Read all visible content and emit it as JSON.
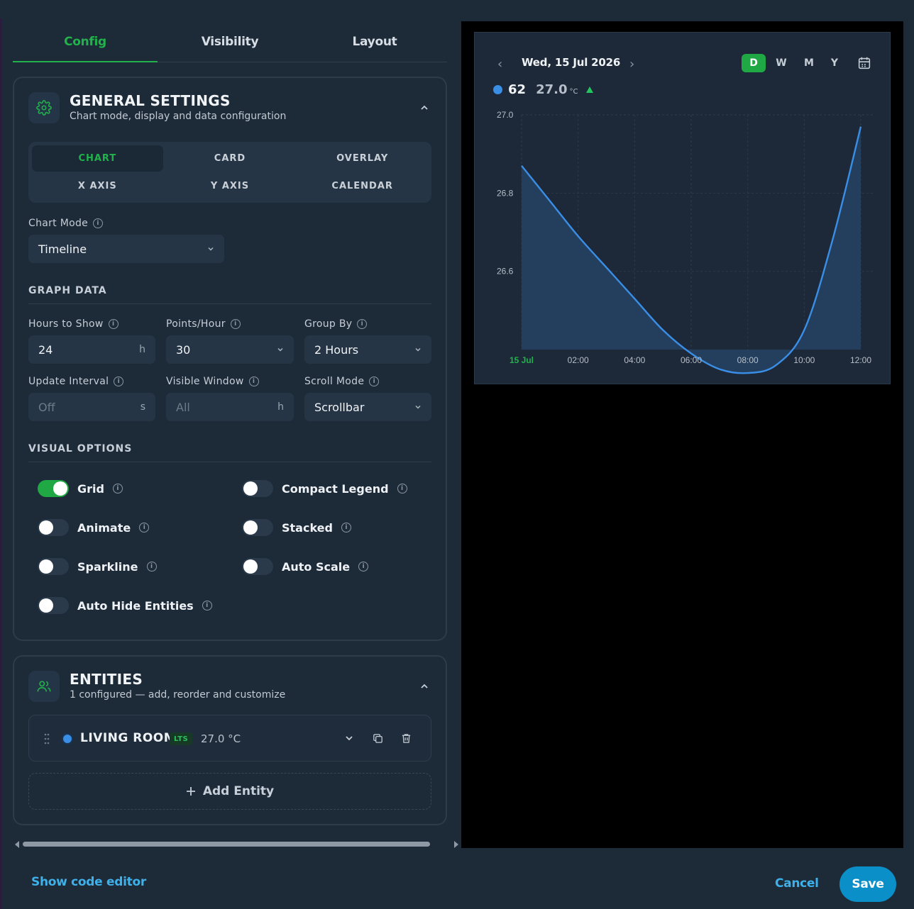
{
  "tabs": [
    {
      "label": "Config",
      "active": true
    },
    {
      "label": "Visibility",
      "active": false
    },
    {
      "label": "Layout",
      "active": false
    }
  ],
  "general": {
    "title": "GENERAL SETTINGS",
    "subtitle": "Chart mode, display and data configuration",
    "segments": [
      "CHART",
      "CARD",
      "OVERLAY",
      "X AXIS",
      "Y AXIS",
      "CALENDAR"
    ],
    "active_segment": "CHART",
    "chart_mode_label": "Chart Mode",
    "chart_mode_value": "Timeline",
    "graph_data_heading": "GRAPH DATA",
    "hours_label": "Hours to Show",
    "hours_value": "24",
    "hours_unit": "h",
    "points_label": "Points/Hour",
    "points_value": "30",
    "group_label": "Group By",
    "group_value": "2 Hours",
    "update_label": "Update Interval",
    "update_placeholder": "Off",
    "update_unit": "s",
    "window_label": "Visible Window",
    "window_placeholder": "All",
    "window_unit": "h",
    "scroll_label": "Scroll Mode",
    "scroll_value": "Scrollbar",
    "visual_heading": "VISUAL OPTIONS",
    "options": [
      {
        "label": "Grid",
        "on": true
      },
      {
        "label": "Compact Legend",
        "on": false
      },
      {
        "label": "Animate",
        "on": false
      },
      {
        "label": "Stacked",
        "on": false
      },
      {
        "label": "Sparkline",
        "on": false
      },
      {
        "label": "Auto Scale",
        "on": false
      },
      {
        "label": "Auto Hide Entities",
        "on": false
      }
    ]
  },
  "entities": {
    "title": "ENTITIES",
    "subtitle": "1 configured — add, reorder and customize",
    "rows": [
      {
        "name": "LIVING ROOM",
        "badge": "LTS",
        "value": "27.0 °C",
        "color": "#3a8ee6"
      }
    ],
    "add_label": "Add Entity"
  },
  "preview": {
    "date": "Wed, 15 Jul 2026",
    "prev": "‹",
    "next": "›",
    "ranges": [
      "D",
      "W",
      "M",
      "Y"
    ],
    "active_range": "D",
    "legend_name": "62",
    "legend_value": "27.0",
    "legend_unit": "°C",
    "legend_trend": "up"
  },
  "chart_data": {
    "type": "area",
    "x": [
      "00:00",
      "01:00",
      "02:00",
      "03:00",
      "04:00",
      "05:00",
      "06:00",
      "07:00",
      "08:00",
      "09:00",
      "10:00",
      "11:00",
      "12:00"
    ],
    "xticks": [
      "15 Jul",
      "02:00",
      "04:00",
      "06:00",
      "08:00",
      "10:00",
      "12:00"
    ],
    "series": [
      {
        "color": "#3a8ee6",
        "values": [
          26.87,
          26.78,
          26.69,
          26.61,
          26.53,
          26.45,
          26.39,
          26.35,
          26.34,
          26.36,
          26.45,
          26.68,
          26.97
        ]
      }
    ],
    "yticks": [
      27.0,
      26.8,
      26.6
    ],
    "ylim": [
      26.4,
      27.0
    ],
    "grid": true
  },
  "footer": {
    "show_code": "Show code editor",
    "cancel": "Cancel",
    "save": "Save"
  }
}
